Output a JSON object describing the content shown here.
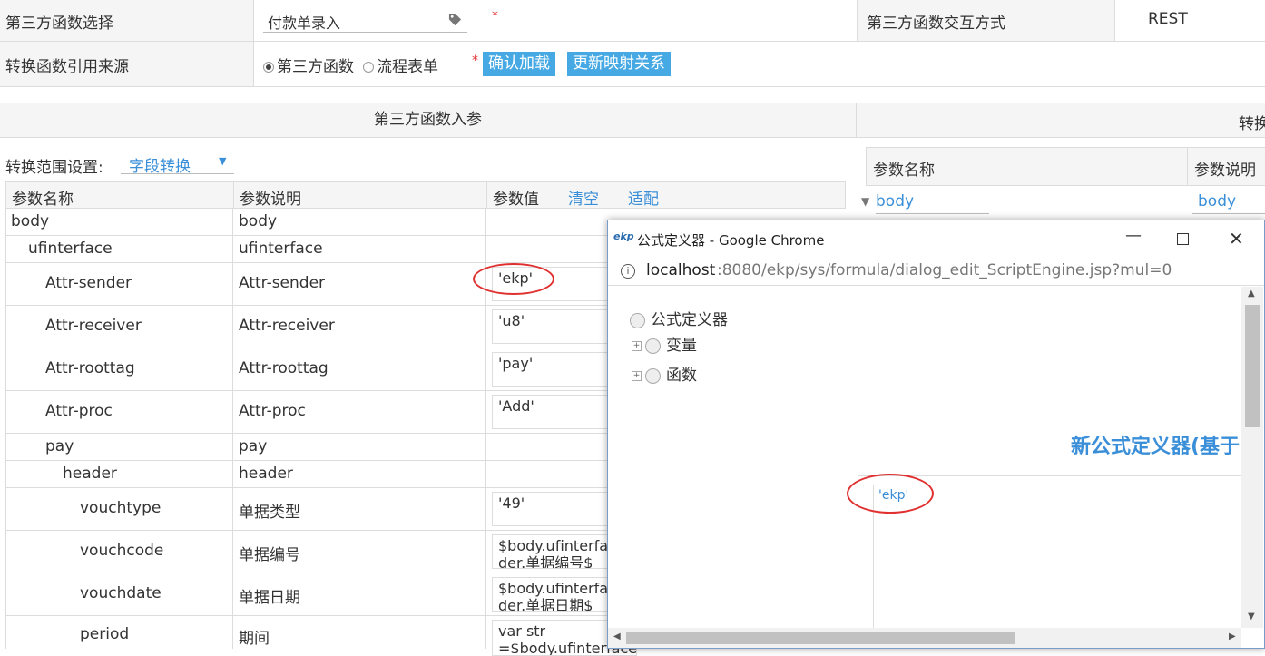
{
  "form": {
    "func_select_label": "第三方函数选择",
    "func_select_value": "付款单录入",
    "required_mark": "*",
    "interaction_label": "第三方函数交互方式",
    "interaction_value": "REST",
    "source_label": "转换函数引用来源",
    "radio_third_party": "第三方函数",
    "radio_flow_form": "流程表单",
    "confirm_load": "确认加载",
    "update_mapping": "更新映射关系"
  },
  "input_params": {
    "header": "第三方函数入参",
    "scope_label": "转换范围设置:",
    "scope_value": "字段转换",
    "col_name": "参数名称",
    "col_desc": "参数说明",
    "col_value": "参数值",
    "clear": "清空",
    "adapt": "适配",
    "rows": [
      {
        "name": "body",
        "desc": "body",
        "value": ""
      },
      {
        "name": "ufinterface",
        "desc": "ufinterface",
        "value": ""
      },
      {
        "name": "Attr-sender",
        "desc": "Attr-sender",
        "value": "'ekp'"
      },
      {
        "name": "Attr-receiver",
        "desc": "Attr-receiver",
        "value": "'u8'"
      },
      {
        "name": "Attr-roottag",
        "desc": "Attr-roottag",
        "value": "'pay'"
      },
      {
        "name": "Attr-proc",
        "desc": "Attr-proc",
        "value": "'Add'"
      },
      {
        "name": "pay",
        "desc": "pay",
        "value": ""
      },
      {
        "name": "header",
        "desc": "header",
        "value": ""
      },
      {
        "name": "vouchtype",
        "desc": "单据类型",
        "value": "'49'"
      },
      {
        "name": "vouchcode",
        "desc": "单据编号",
        "value": "$body.ufinterface.pay.hea der.单据编号$"
      },
      {
        "name": "vouchdate",
        "desc": "单据日期",
        "value": "$body.ufinterface.pay.hea der.单据日期$"
      },
      {
        "name": "period",
        "desc": "期间",
        "value": "var str =$body.ufinterface.pay.he"
      }
    ]
  },
  "right_panel": {
    "header": "转换",
    "col_name": "参数名称",
    "col_desc": "参数说明",
    "row_name": "body",
    "row_desc": "body"
  },
  "popup": {
    "title": "公式定义器 - Google Chrome",
    "logo": "ekp",
    "url_host": "localhost",
    "url_rest": ":8080/ekp/sys/formula/dialog_edit_ScriptEngine.jsp?mul=0",
    "tree_root": "公式定义器",
    "tree_var": "变量",
    "tree_func": "函数",
    "heading": "新公式定义器(基于",
    "editor_value": "'ekp'"
  }
}
